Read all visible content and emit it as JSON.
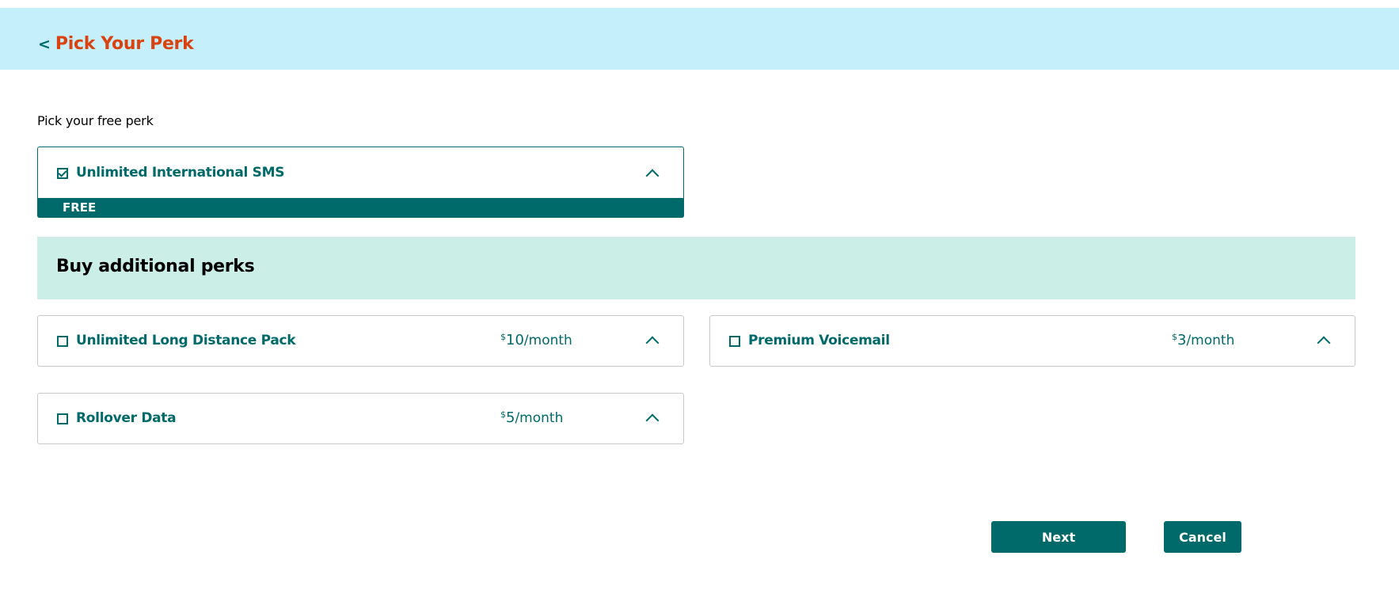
{
  "header": {
    "back_chevron": "<",
    "title": "Pick Your Perk"
  },
  "intro_text": "Pick your free perk",
  "free_perk": {
    "name": "Unlimited International SMS",
    "checked": true,
    "badge": "FREE"
  },
  "additional_section": {
    "title": "Buy additional perks"
  },
  "perks": [
    {
      "name": "Unlimited Long Distance Pack",
      "currency": "$",
      "amount": "10",
      "per": "/month",
      "checked": false
    },
    {
      "name": "Premium Voicemail",
      "currency": "$",
      "amount": "3",
      "per": "/month",
      "checked": false
    },
    {
      "name": "Rollover Data",
      "currency": "$",
      "amount": "5",
      "per": "/month",
      "checked": false
    }
  ],
  "buttons": {
    "next": "Next",
    "cancel": "Cancel"
  },
  "colors": {
    "header_bg": "#c5effb",
    "title_orange": "#d94310",
    "teal": "#006a6a",
    "section_bg": "#cbefe6"
  }
}
